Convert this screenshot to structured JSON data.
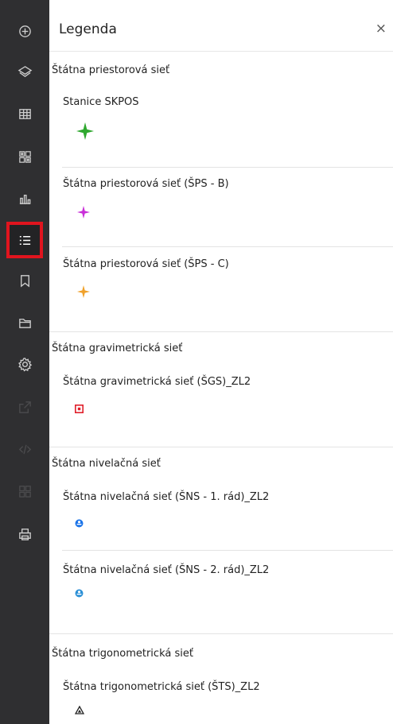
{
  "legend": {
    "title": "Legenda",
    "close": "×"
  },
  "groups": [
    {
      "title": "Štátna priestorová sieť",
      "layers": [
        {
          "title": "Stanice SKPOS",
          "symbol": "star-symbol",
          "color": "#2fa82f"
        },
        {
          "title": "Štátna priestorová sieť (ŠPS - B)",
          "symbol": "star-symbol",
          "color": "#c92fd8"
        },
        {
          "title": "Štátna priestorová sieť (ŠPS - C)",
          "symbol": "star-symbol",
          "color": "#f0a12a"
        }
      ]
    },
    {
      "title": "Štátna gravimetrická sieť",
      "layers": [
        {
          "title": "Štátna gravimetrická sieť (ŠGS)_ZL2",
          "symbol": "square-dot-symbol",
          "color": "#e0202b"
        }
      ]
    },
    {
      "title": "Štátna nivelačná sieť",
      "layers": [
        {
          "title": "Štátna nivelačná sieť (ŠNS - 1. rád)_ZL2",
          "symbol": "circle-marker-symbol",
          "color": "#1a73e8"
        },
        {
          "title": "Štátna nivelačná sieť (ŠNS - 2. rád)_ZL2",
          "symbol": "circle-marker-symbol",
          "color": "#2b8fd6"
        }
      ]
    },
    {
      "title": "Štátna trigonometrická sieť",
      "layers": [
        {
          "title": "Štátna trigonometrická sieť (ŠTS)_ZL2",
          "symbol": "triangle-symbol",
          "color": "#222222"
        }
      ]
    }
  ],
  "sidebar": {
    "buttons": [
      {
        "name": "add-data-icon"
      },
      {
        "name": "layers-icon"
      },
      {
        "name": "table-icon"
      },
      {
        "name": "qr-grid-icon"
      },
      {
        "name": "chart-icon"
      },
      {
        "name": "legend-icon",
        "active": true
      },
      {
        "name": "bookmark-icon"
      },
      {
        "name": "folder-icon"
      },
      {
        "name": "settings-icon"
      },
      {
        "name": "share-icon",
        "disabled": true
      },
      {
        "name": "embed-icon",
        "disabled": true
      },
      {
        "name": "grid-icon",
        "disabled": true
      },
      {
        "name": "print-icon"
      }
    ]
  },
  "colors": {
    "sidebar_bg": "#2f2f31",
    "active_outline": "#e0141e"
  }
}
